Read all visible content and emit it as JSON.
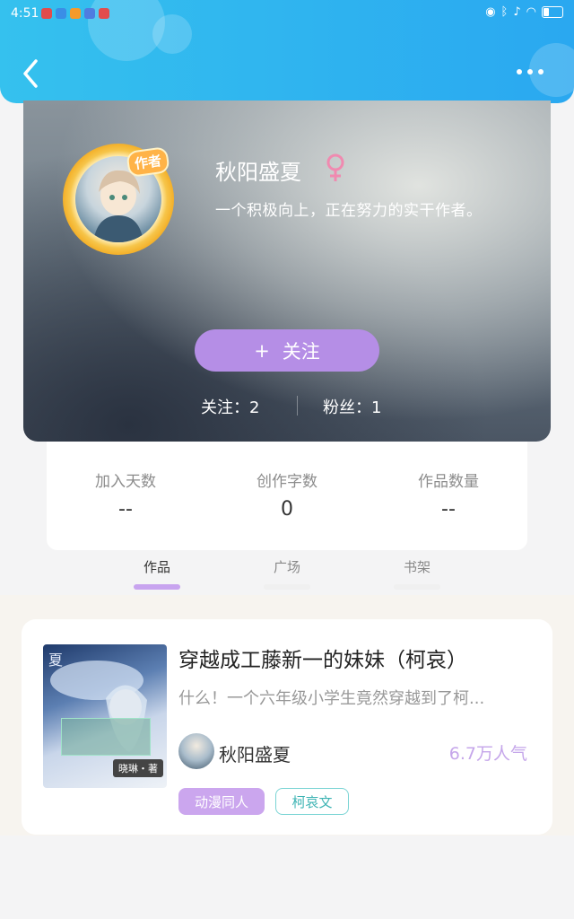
{
  "status_bar": {
    "time": "4:51"
  },
  "profile": {
    "name": "秋阳盛夏",
    "author_tag": "作者",
    "bio": "一个积极向上，正在努力的实干作者。",
    "follow_button": "关注",
    "follow_plus": "+",
    "following": "关注：2",
    "followers": "粉丝：1"
  },
  "stats": [
    {
      "label": "加入天数",
      "value": "--"
    },
    {
      "label": "创作字数",
      "value": "0"
    },
    {
      "label": "作品数量",
      "value": "--"
    }
  ],
  "tabs": [
    {
      "label": "作品",
      "active": true
    },
    {
      "label": "广场",
      "active": false
    },
    {
      "label": "书架",
      "active": false
    }
  ],
  "book": {
    "title": "穿越成工藤新一的妹妹（柯哀）",
    "description": "什么！一个六年级小学生竟然穿越到了柯...",
    "author": "秋阳盛夏",
    "popularity": "6.7万人气",
    "cover_badge": "晓琳・著",
    "cover_char": "夏",
    "tags": [
      "动漫同人",
      "柯哀文"
    ]
  },
  "colors": {
    "header": "#2aa8f0",
    "accent_purple": "#b58ee6",
    "tag_teal": "#3eb4b4",
    "popularity": "#c5a6ea"
  }
}
